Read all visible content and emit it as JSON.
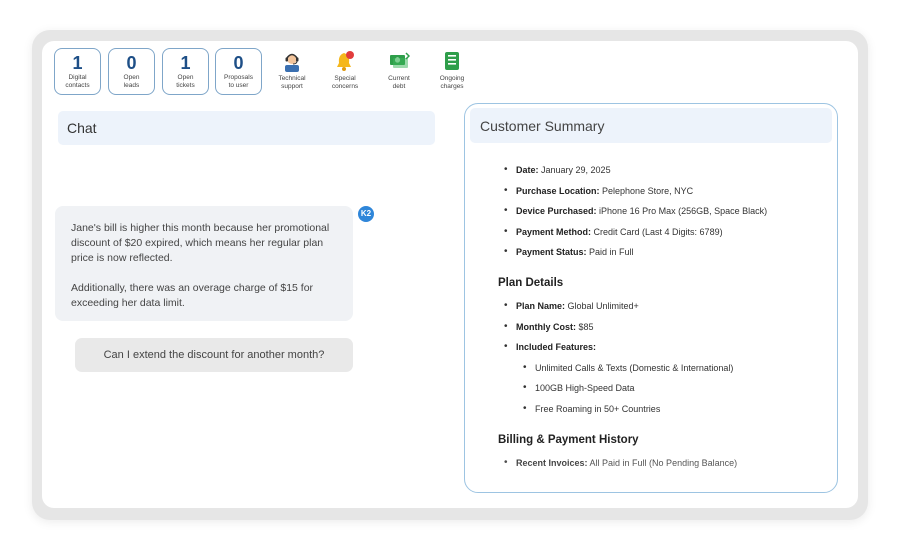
{
  "stats": [
    {
      "value": "1",
      "label": "Digital\ncontacts"
    },
    {
      "value": "0",
      "label": "Open\nleads"
    },
    {
      "value": "1",
      "label": "Open\ntickets"
    },
    {
      "value": "0",
      "label": "Proposals\nto user"
    }
  ],
  "tools": [
    {
      "label": "Technical\nsupport",
      "icon": "technical-support-icon"
    },
    {
      "label": "Special\nconcerns",
      "icon": "bell-alert-icon"
    },
    {
      "label": "Current\ndebt",
      "icon": "money-bill-icon"
    },
    {
      "label": "Ongoing\ncharges",
      "icon": "charges-sheet-icon"
    }
  ],
  "chat": {
    "title": "Chat",
    "avatar_text": "K2",
    "message_paragraphs": [
      "Jane's bill is higher this month because her promotional discount of $20 expired, which means her regular plan price is now reflected.",
      "Additionally, there was an overage charge of $15 for exceeding her data limit."
    ],
    "suggestion": "Can I extend the discount for another month?"
  },
  "summary": {
    "title": "Customer Summary",
    "purchase": [
      {
        "label": "Date:",
        "value": " January 29, 2025"
      },
      {
        "label": "Purchase Location:",
        "value": " Pelephone Store, NYC"
      },
      {
        "label": "Device Purchased:",
        "value": " iPhone 16 Pro Max (256GB, Space Black)"
      },
      {
        "label": "Payment Method:",
        "value": " Credit Card (Last 4 Digits: 6789)"
      },
      {
        "label": "Payment Status:",
        "value": " Paid in Full"
      }
    ],
    "plan_heading": "Plan Details",
    "plan": [
      {
        "label": "Plan Name:",
        "value": " Global Unlimited+"
      },
      {
        "label": "Monthly Cost:",
        "value": " $85"
      },
      {
        "label": "Included Features:",
        "value": ""
      }
    ],
    "features": [
      "Unlimited Calls & Texts (Domestic & International)",
      "100GB High-Speed Data",
      "Free Roaming in 50+ Countries"
    ],
    "billing_heading": "Billing & Payment History",
    "billing": [
      {
        "label": "Recent Invoices:",
        "value": " All Paid in Full (No Pending Balance)"
      }
    ]
  },
  "colors": {
    "accent": "#1e4f87",
    "header_bg": "#edf3fb",
    "summary_border": "#9dc4e2",
    "bubble_bg": "#f0f2f5"
  }
}
